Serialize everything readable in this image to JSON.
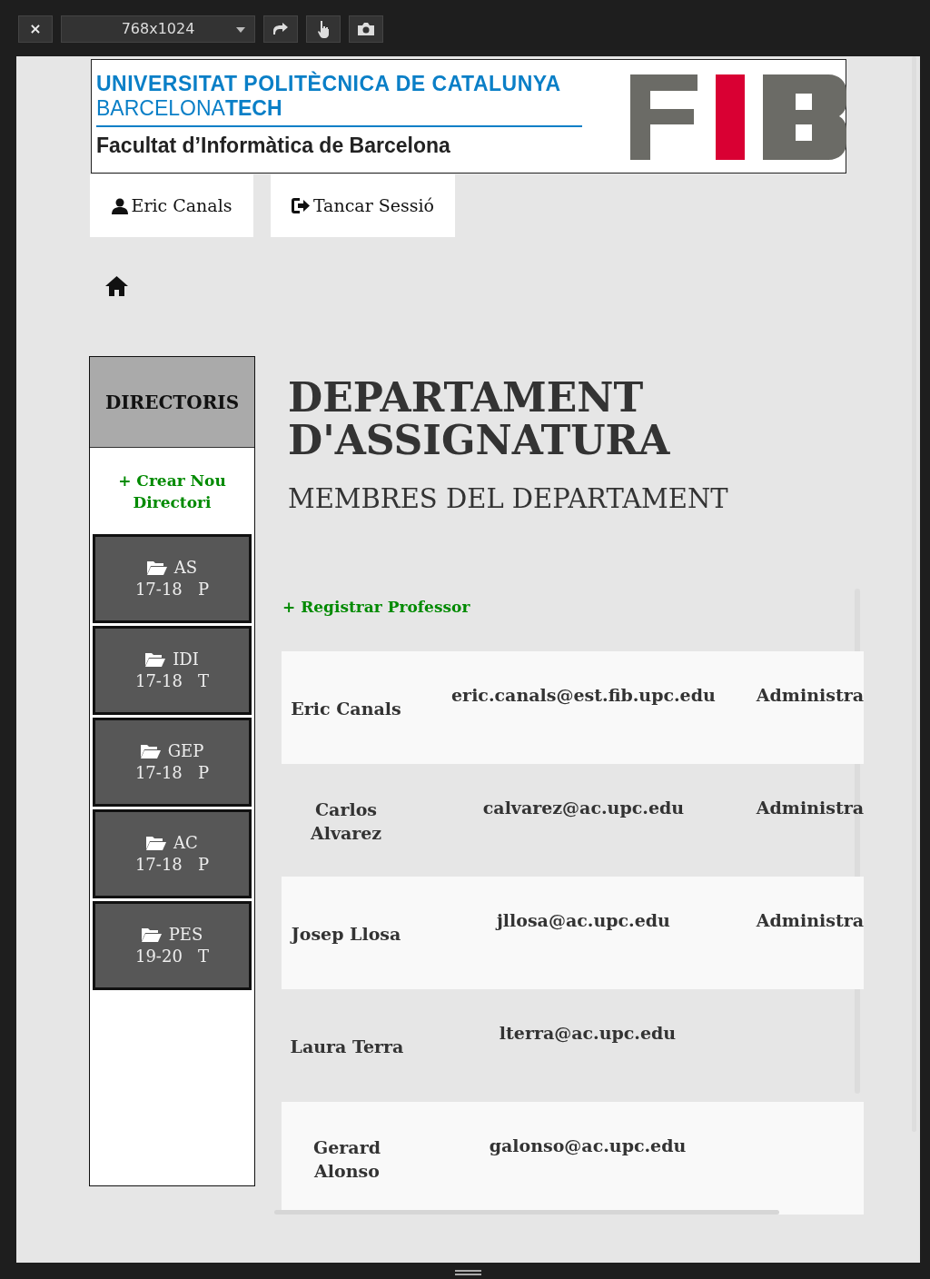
{
  "toolbar": {
    "close": "×",
    "device": "768x1024"
  },
  "banner": {
    "university": "UNIVERSITAT POLITÈCNICA DE CATALUNYA",
    "campus_light": "BARCELONA",
    "campus_bold": "TECH",
    "faculty": "Facultat d’Informàtica de Barcelona"
  },
  "user_bar": [
    {
      "kind": "user",
      "label": "Eric Canals"
    },
    {
      "kind": "logout",
      "label": "Tancar Sessió"
    }
  ],
  "sidebar": {
    "title": "DIRECTORIS",
    "create_link": "+ Crear Nou Directori",
    "items": [
      {
        "name": "AS",
        "year": "17-18",
        "term": "P"
      },
      {
        "name": "IDI",
        "year": "17-18",
        "term": "T"
      },
      {
        "name": "GEP",
        "year": "17-18",
        "term": "P"
      },
      {
        "name": "AC",
        "year": "17-18",
        "term": "P"
      },
      {
        "name": "PES",
        "year": "19-20",
        "term": "T"
      }
    ]
  },
  "main": {
    "title": "DEPARTAMENT D'ASSIGNATURA",
    "subtitle": "MEMBRES DEL DEPARTAMENT",
    "register_link": "+ Registrar Professor",
    "rows": [
      {
        "name": "Eric Canals",
        "email": "eric.canals@est.fib.upc.edu",
        "role": "Administra"
      },
      {
        "name": "Carlos Alvarez",
        "email": "calvarez@ac.upc.edu",
        "role": "Administra"
      },
      {
        "name": "Josep Llosa",
        "email": "jllosa@ac.upc.edu",
        "role": "Administra"
      },
      {
        "name": "Laura Terra",
        "email": "lterra@ac.upc.edu"
      },
      {
        "name": "Gerard Alonso",
        "email": "galonso@ac.upc.edu"
      }
    ]
  }
}
